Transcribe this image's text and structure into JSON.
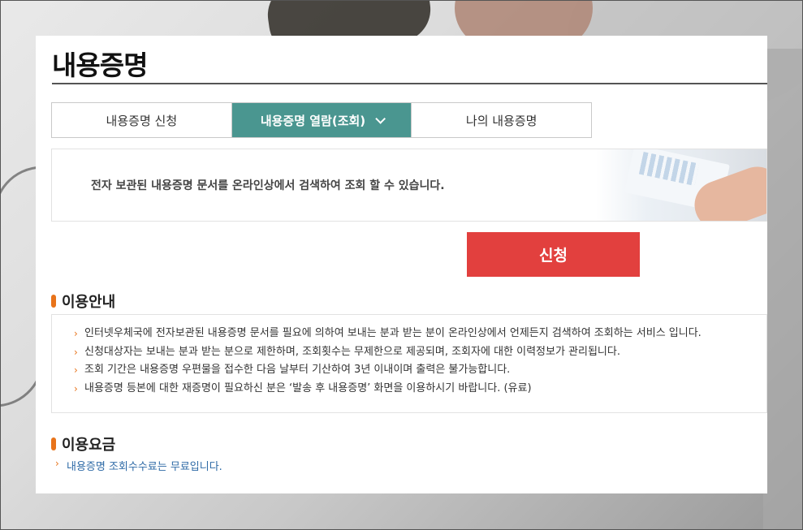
{
  "page": {
    "title": "내용증명"
  },
  "tabs": [
    {
      "label": "내용증명 신청",
      "active": false
    },
    {
      "label": "내용증명 열람(조회)",
      "active": true
    },
    {
      "label": "나의 내용증명",
      "active": false
    }
  ],
  "banner": {
    "text": "전자 보관된 내용증명 문서를 온라인상에서 검색하여 조회 할 수 있습니다."
  },
  "apply_button": {
    "label": "신청"
  },
  "usage_guide": {
    "title": "이용안내",
    "items": [
      "인터넷우체국에 전자보관된 내용증명 문서를 필요에 의하여 보내는 분과 받는 분이 온라인상에서 언제든지 검색하여 조회하는 서비스 입니다.",
      "신청대상자는 보내는 분과 받는 분으로 제한하며, 조회횟수는 무제한으로 제공되며, 조회자에 대한 이력정보가 관리됩니다.",
      "조회 기간은 내용증명 우편물을 접수한 다음 날부터 기산하여 3년 이내이며 출력은 불가능합니다.",
      "내용증명 등본에 대한 재증명이 필요하신 분은 ‘발송 후 내용증명’ 화면을 이용하시기 바랍니다. (유료)"
    ]
  },
  "usage_fee": {
    "title": "이용요금",
    "text": "내용증명 조회수수료는 무료입니다."
  },
  "colors": {
    "active_tab": "#4a9690",
    "apply_button": "#e2403e",
    "section_mark": "#e8731a",
    "fee_text": "#2e6aa6"
  },
  "icons": {
    "tab_dropdown": "chevron-down-icon",
    "list_bullet": "chevron-right-icon",
    "section_marker": "section-marker-icon"
  }
}
